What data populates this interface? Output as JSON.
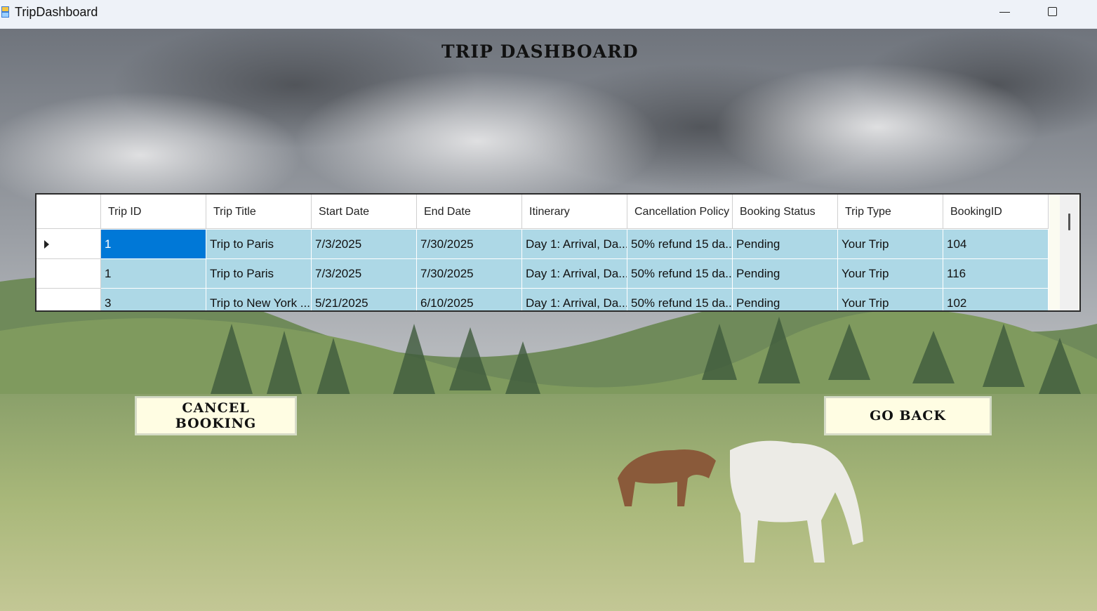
{
  "window": {
    "title": "TripDashboard",
    "icon": "app-window-icon"
  },
  "form": {
    "title": "TRIP DASHBOARD"
  },
  "grid": {
    "columns": [
      "Trip ID",
      "Trip Title",
      "Start Date",
      "End Date",
      "Itinerary",
      "Cancellation Policy",
      "Booking Status",
      "Trip Type",
      "BookingID"
    ],
    "rows": [
      [
        "1",
        "Trip to Paris",
        "7/3/2025",
        "7/30/2025",
        "Day 1: Arrival, Da...",
        "50% refund 15 da...",
        "Pending",
        "Your Trip",
        "104"
      ],
      [
        "1",
        "Trip to Paris",
        "7/3/2025",
        "7/30/2025",
        "Day 1: Arrival, Da...",
        "50% refund 15 da...",
        "Pending",
        "Your Trip",
        "116"
      ],
      [
        "3",
        "Trip to New York ...",
        "5/21/2025",
        "6/10/2025",
        "Day 1: Arrival, Da...",
        "50% refund 15 da...",
        "Pending",
        "Your Trip",
        "102"
      ]
    ],
    "selected_row": 0,
    "colors": {
      "cell": "#add8e6",
      "selected": "#0078d7"
    }
  },
  "buttons": {
    "cancel_label": "CANCEL BOOKING",
    "back_label": "GO BACK"
  }
}
